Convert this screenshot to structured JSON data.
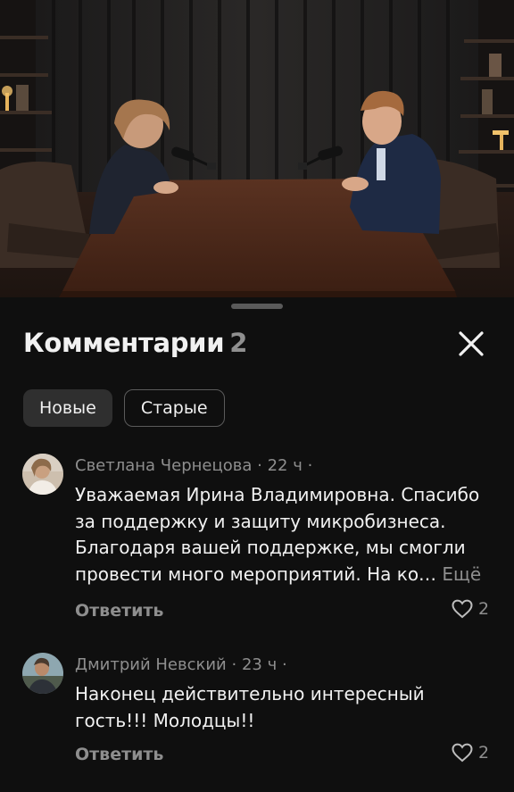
{
  "header": {
    "title": "Комментарии",
    "count": "2"
  },
  "filters": [
    {
      "label": "Новые",
      "active": true
    },
    {
      "label": "Старые",
      "active": false
    }
  ],
  "comments": [
    {
      "author": "Светлана Чернецова",
      "time": "22 ч",
      "text": "Уважаемая Ирина Владимировна. Спасибо за поддержку и защиту микробизнеса. Благодаря вашей поддержке, мы смогли провести много мероприятий. На ко…",
      "more_label": "Ещё",
      "reply_label": "Ответить",
      "likes": "2"
    },
    {
      "author": "Дмитрий Невский",
      "time": "23 ч",
      "text": "Наконец действительно интересный гость!!! Молодцы!!",
      "reply_label": "Ответить",
      "likes": "2"
    }
  ],
  "icons": {
    "close": "close-icon",
    "like": "heart-outline-icon",
    "menu": "more-vert-icon"
  },
  "colors": {
    "background": "#0f0f0f",
    "secondary_text": "#8e8e8e",
    "active_chip": "#2f2f2f"
  }
}
